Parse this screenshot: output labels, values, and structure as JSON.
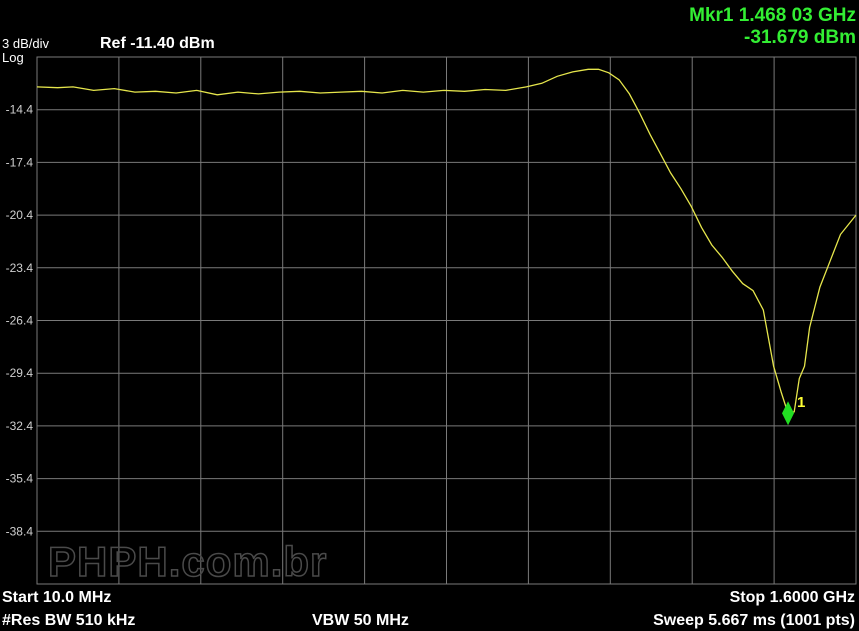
{
  "header": {
    "scale": "3 dB/div",
    "scale_type": "Log",
    "ref_level": "Ref -11.40 dBm",
    "marker_freq": "Mkr1 1.468 03 GHz",
    "marker_amp": "-31.679 dBm"
  },
  "footer": {
    "start": "Start 10.0 MHz",
    "stop": "Stop 1.6000 GHz",
    "rbw": "#Res BW 510 kHz",
    "vbw": "VBW 50 MHz",
    "sweep": "Sweep  5.667 ms (1001 pts)"
  },
  "watermark": "PHPH.com.br",
  "colors": {
    "trace": "#e6e64c",
    "marker": "#22dd22",
    "marker_label": "#ffff33",
    "readout": "#33ee33",
    "grid": "#7a7a7a",
    "text": "#ffffff"
  },
  "chart_data": {
    "type": "line",
    "title": "",
    "xlabel": "",
    "ylabel": "",
    "x_unit": "GHz",
    "y_unit": "dBm",
    "xlim": [
      0.01,
      1.6
    ],
    "ylim": [
      -41.4,
      -11.4
    ],
    "grid": true,
    "y_ticks": [
      -14.4,
      -17.4,
      -20.4,
      -23.4,
      -26.4,
      -29.4,
      -32.4,
      -35.4,
      -38.4
    ],
    "series": [
      {
        "x": [
          0.01,
          0.05,
          0.08,
          0.12,
          0.16,
          0.2,
          0.24,
          0.28,
          0.32,
          0.36,
          0.4,
          0.44,
          0.48,
          0.52,
          0.56,
          0.6,
          0.64,
          0.68,
          0.72,
          0.76,
          0.8,
          0.84,
          0.88,
          0.92,
          0.96,
          0.99,
          1.02,
          1.05,
          1.08,
          1.1,
          1.12,
          1.14,
          1.16,
          1.18,
          1.2,
          1.22,
          1.24,
          1.26,
          1.28,
          1.3,
          1.32,
          1.34,
          1.36,
          1.38,
          1.4,
          1.42,
          1.44,
          1.455,
          1.468,
          1.48,
          1.49,
          1.5,
          1.51,
          1.53,
          1.55,
          1.57,
          1.6
        ],
        "y": [
          -13.1,
          -13.15,
          -13.1,
          -13.3,
          -13.2,
          -13.4,
          -13.35,
          -13.45,
          -13.3,
          -13.55,
          -13.4,
          -13.5,
          -13.4,
          -13.35,
          -13.45,
          -13.4,
          -13.35,
          -13.45,
          -13.3,
          -13.4,
          -13.3,
          -13.35,
          -13.25,
          -13.3,
          -13.1,
          -12.9,
          -12.5,
          -12.25,
          -12.1,
          -12.1,
          -12.3,
          -12.7,
          -13.5,
          -14.6,
          -15.8,
          -16.9,
          -18.0,
          -18.9,
          -19.9,
          -21.1,
          -22.1,
          -22.8,
          -23.6,
          -24.3,
          -24.7,
          -25.8,
          -29.0,
          -30.5,
          -31.68,
          -31.6,
          -29.7,
          -29.0,
          -26.8,
          -24.5,
          -23.0,
          -21.5,
          -20.4
        ]
      }
    ],
    "marker": {
      "label": "1",
      "x": 1.46803,
      "y": -31.679
    }
  }
}
